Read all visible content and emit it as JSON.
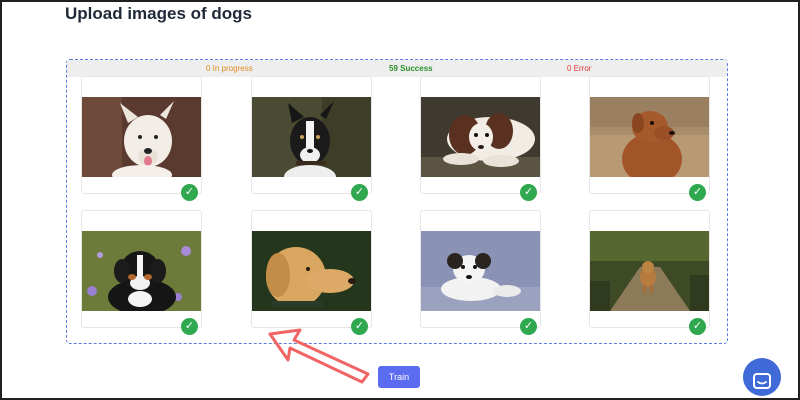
{
  "page": {
    "title": "Upload images of dogs"
  },
  "status": {
    "in_progress": "0 In progress",
    "success": "59 Success",
    "error": "0 Error"
  },
  "images": [
    {
      "subject": "white shepherd dog",
      "status": "success"
    },
    {
      "subject": "black and white terrier",
      "status": "success"
    },
    {
      "subject": "spaniel lying down",
      "status": "success"
    },
    {
      "subject": "rhodesian ridgeback",
      "status": "success"
    },
    {
      "subject": "bernese puppy in flowers",
      "status": "success"
    },
    {
      "subject": "yellow labrador",
      "status": "success"
    },
    {
      "subject": "jack russell lying down",
      "status": "success"
    },
    {
      "subject": "small dog on forest path",
      "status": "success"
    }
  ],
  "actions": {
    "train_label": "Train"
  },
  "colors": {
    "accent": "#5b6cf0",
    "success": "#2fa84f",
    "progress": "#e08a1e",
    "error": "#e03a3a",
    "dropzone_border": "#5b7be0",
    "chat": "#3f6ad8",
    "annotation_arrow": "#f06464"
  },
  "icons": {
    "status_check": "check-icon",
    "chat": "chat-icon",
    "annotation": "arrow-annotation"
  }
}
